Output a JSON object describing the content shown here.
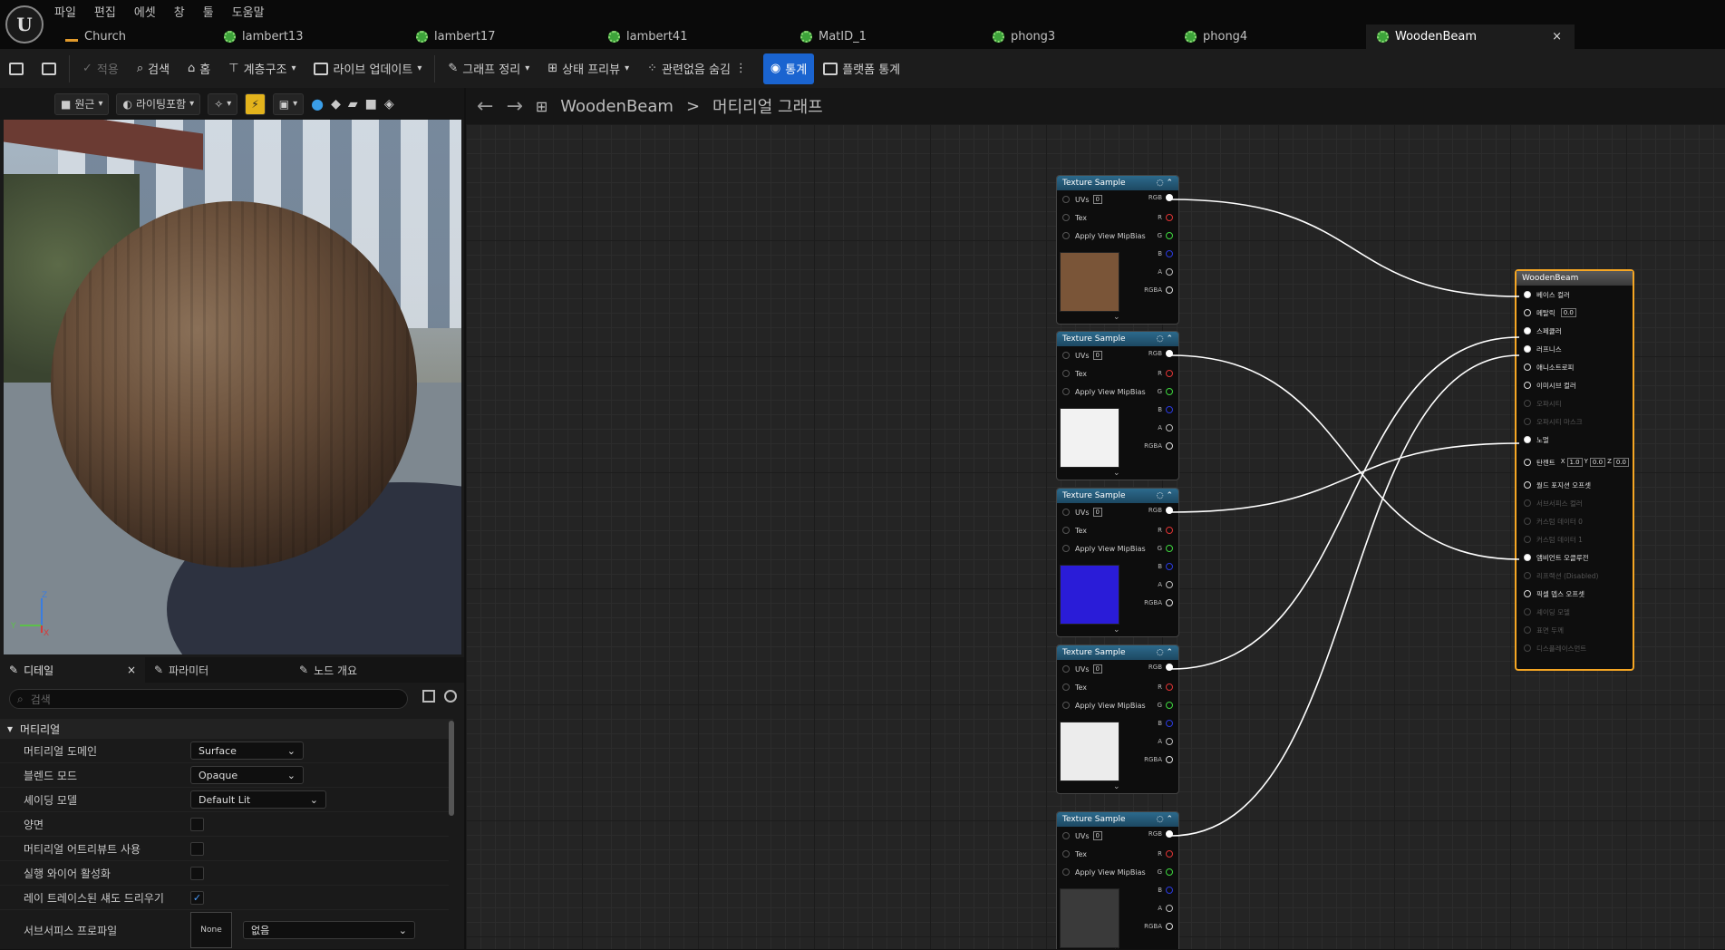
{
  "menu": [
    "파일",
    "편집",
    "에셋",
    "창",
    "툴",
    "도움말"
  ],
  "tabs": [
    {
      "label": "Church",
      "icon": "material-warning-icon"
    },
    {
      "label": "lambert13",
      "icon": "material-icon"
    },
    {
      "label": "lambert17",
      "icon": "material-icon"
    },
    {
      "label": "lambert41",
      "icon": "material-icon"
    },
    {
      "label": "MatID_1",
      "icon": "material-icon"
    },
    {
      "label": "phong3",
      "icon": "material-icon"
    },
    {
      "label": "phong4",
      "icon": "material-icon"
    },
    {
      "label": "WoodenBeam",
      "icon": "material-icon",
      "close": "×"
    }
  ],
  "toolbar": {
    "apply": "적용",
    "search": "검색",
    "home": "홈",
    "hierarchy": "계층구조",
    "live_update": "라이브 업데이트",
    "graph_cleanup": "그래프 정리",
    "state_preview": "상태 프리뷰",
    "hide_unrelated": "관련없음 숨김",
    "stats": "통계",
    "platform_stats": "플랫폼 통계"
  },
  "viewport": {
    "perspective": "원근",
    "lighting": "라이팅포함",
    "axis_z": "Z",
    "axis_y": "Y",
    "axis_x": "X"
  },
  "details": {
    "tabs": [
      "디테일",
      "파라미터",
      "노드 개요"
    ],
    "close": "×",
    "search_placeholder": "검색",
    "section": "머티리얼",
    "rows": [
      {
        "label": "머티리얼 도메인",
        "value": "Surface"
      },
      {
        "label": "블렌드 모드",
        "value": "Opaque"
      },
      {
        "label": "셰이딩 모델",
        "value": "Default Lit"
      },
      {
        "label": "양면",
        "checked": false
      },
      {
        "label": "머티리얼 어트리뷰트 사용",
        "checked": false
      },
      {
        "label": "실행 와이어 활성화",
        "checked": false
      },
      {
        "label": "레이 트레이스된 섀도 드리우기",
        "checked": true
      },
      {
        "label": "서브서피스 프로파일",
        "value": "없음",
        "thumb": "None"
      }
    ]
  },
  "graph": {
    "breadcrumb_asset": "WoodenBeam",
    "breadcrumb_sep": ">",
    "breadcrumb_graph": "머티리얼 그래프",
    "texture_nodes": [
      {
        "title": "Texture Sample",
        "uvs": "0",
        "tex_color": "#7a5538"
      },
      {
        "title": "Texture Sample",
        "uvs": "0",
        "tex_color": "#f2f2f2"
      },
      {
        "title": "Texture Sample",
        "uvs": "0",
        "tex_color": "#2a1cd8"
      },
      {
        "title": "Texture Sample",
        "uvs": "0",
        "tex_color": "#ececec"
      },
      {
        "title": "Texture Sample",
        "uvs": "0",
        "tex_color": "#3a3a3a"
      }
    ],
    "pin_labels": {
      "uvs": "UVs",
      "tex": "Tex",
      "mip": "Apply View MipBias",
      "rgb": "RGB",
      "r": "R",
      "g": "G",
      "b": "B",
      "a": "A",
      "rgba": "RGBA"
    },
    "material_node": {
      "title": "WoodenBeam",
      "rows": [
        {
          "label": "베이스 컬러",
          "on": true,
          "connected": true
        },
        {
          "label": "메탈릭",
          "on": true,
          "value": "0.0"
        },
        {
          "label": "스페큘러",
          "on": true,
          "connected": true
        },
        {
          "label": "러프니스",
          "on": true,
          "connected": true
        },
        {
          "label": "애니소트로피",
          "on": true
        },
        {
          "label": "이미시브 컬러",
          "on": true
        },
        {
          "label": "오파시티",
          "on": false
        },
        {
          "label": "오파시티 마스크",
          "on": false
        },
        {
          "label": "노멀",
          "on": true,
          "connected": true
        },
        {
          "label": "탄젠트",
          "on": true,
          "xyz": [
            "1.0",
            "0.0",
            "0.0"
          ]
        },
        {
          "label": "월드 포지션 오프셋",
          "on": true
        },
        {
          "label": "서브서피스 컬러",
          "on": false
        },
        {
          "label": "커스텀 데이터 0",
          "on": false
        },
        {
          "label": "커스텀 데이터 1",
          "on": false
        },
        {
          "label": "앰비언트 오클루전",
          "on": true,
          "connected": true
        },
        {
          "label": "리프랙션 (Disabled)",
          "on": false
        },
        {
          "label": "픽셀 뎁스 오프셋",
          "on": true
        },
        {
          "label": "셰이딩 모델",
          "on": false
        },
        {
          "label": "표면 두께",
          "on": false
        },
        {
          "label": "디스플레이스먼트",
          "on": false
        }
      ]
    }
  }
}
